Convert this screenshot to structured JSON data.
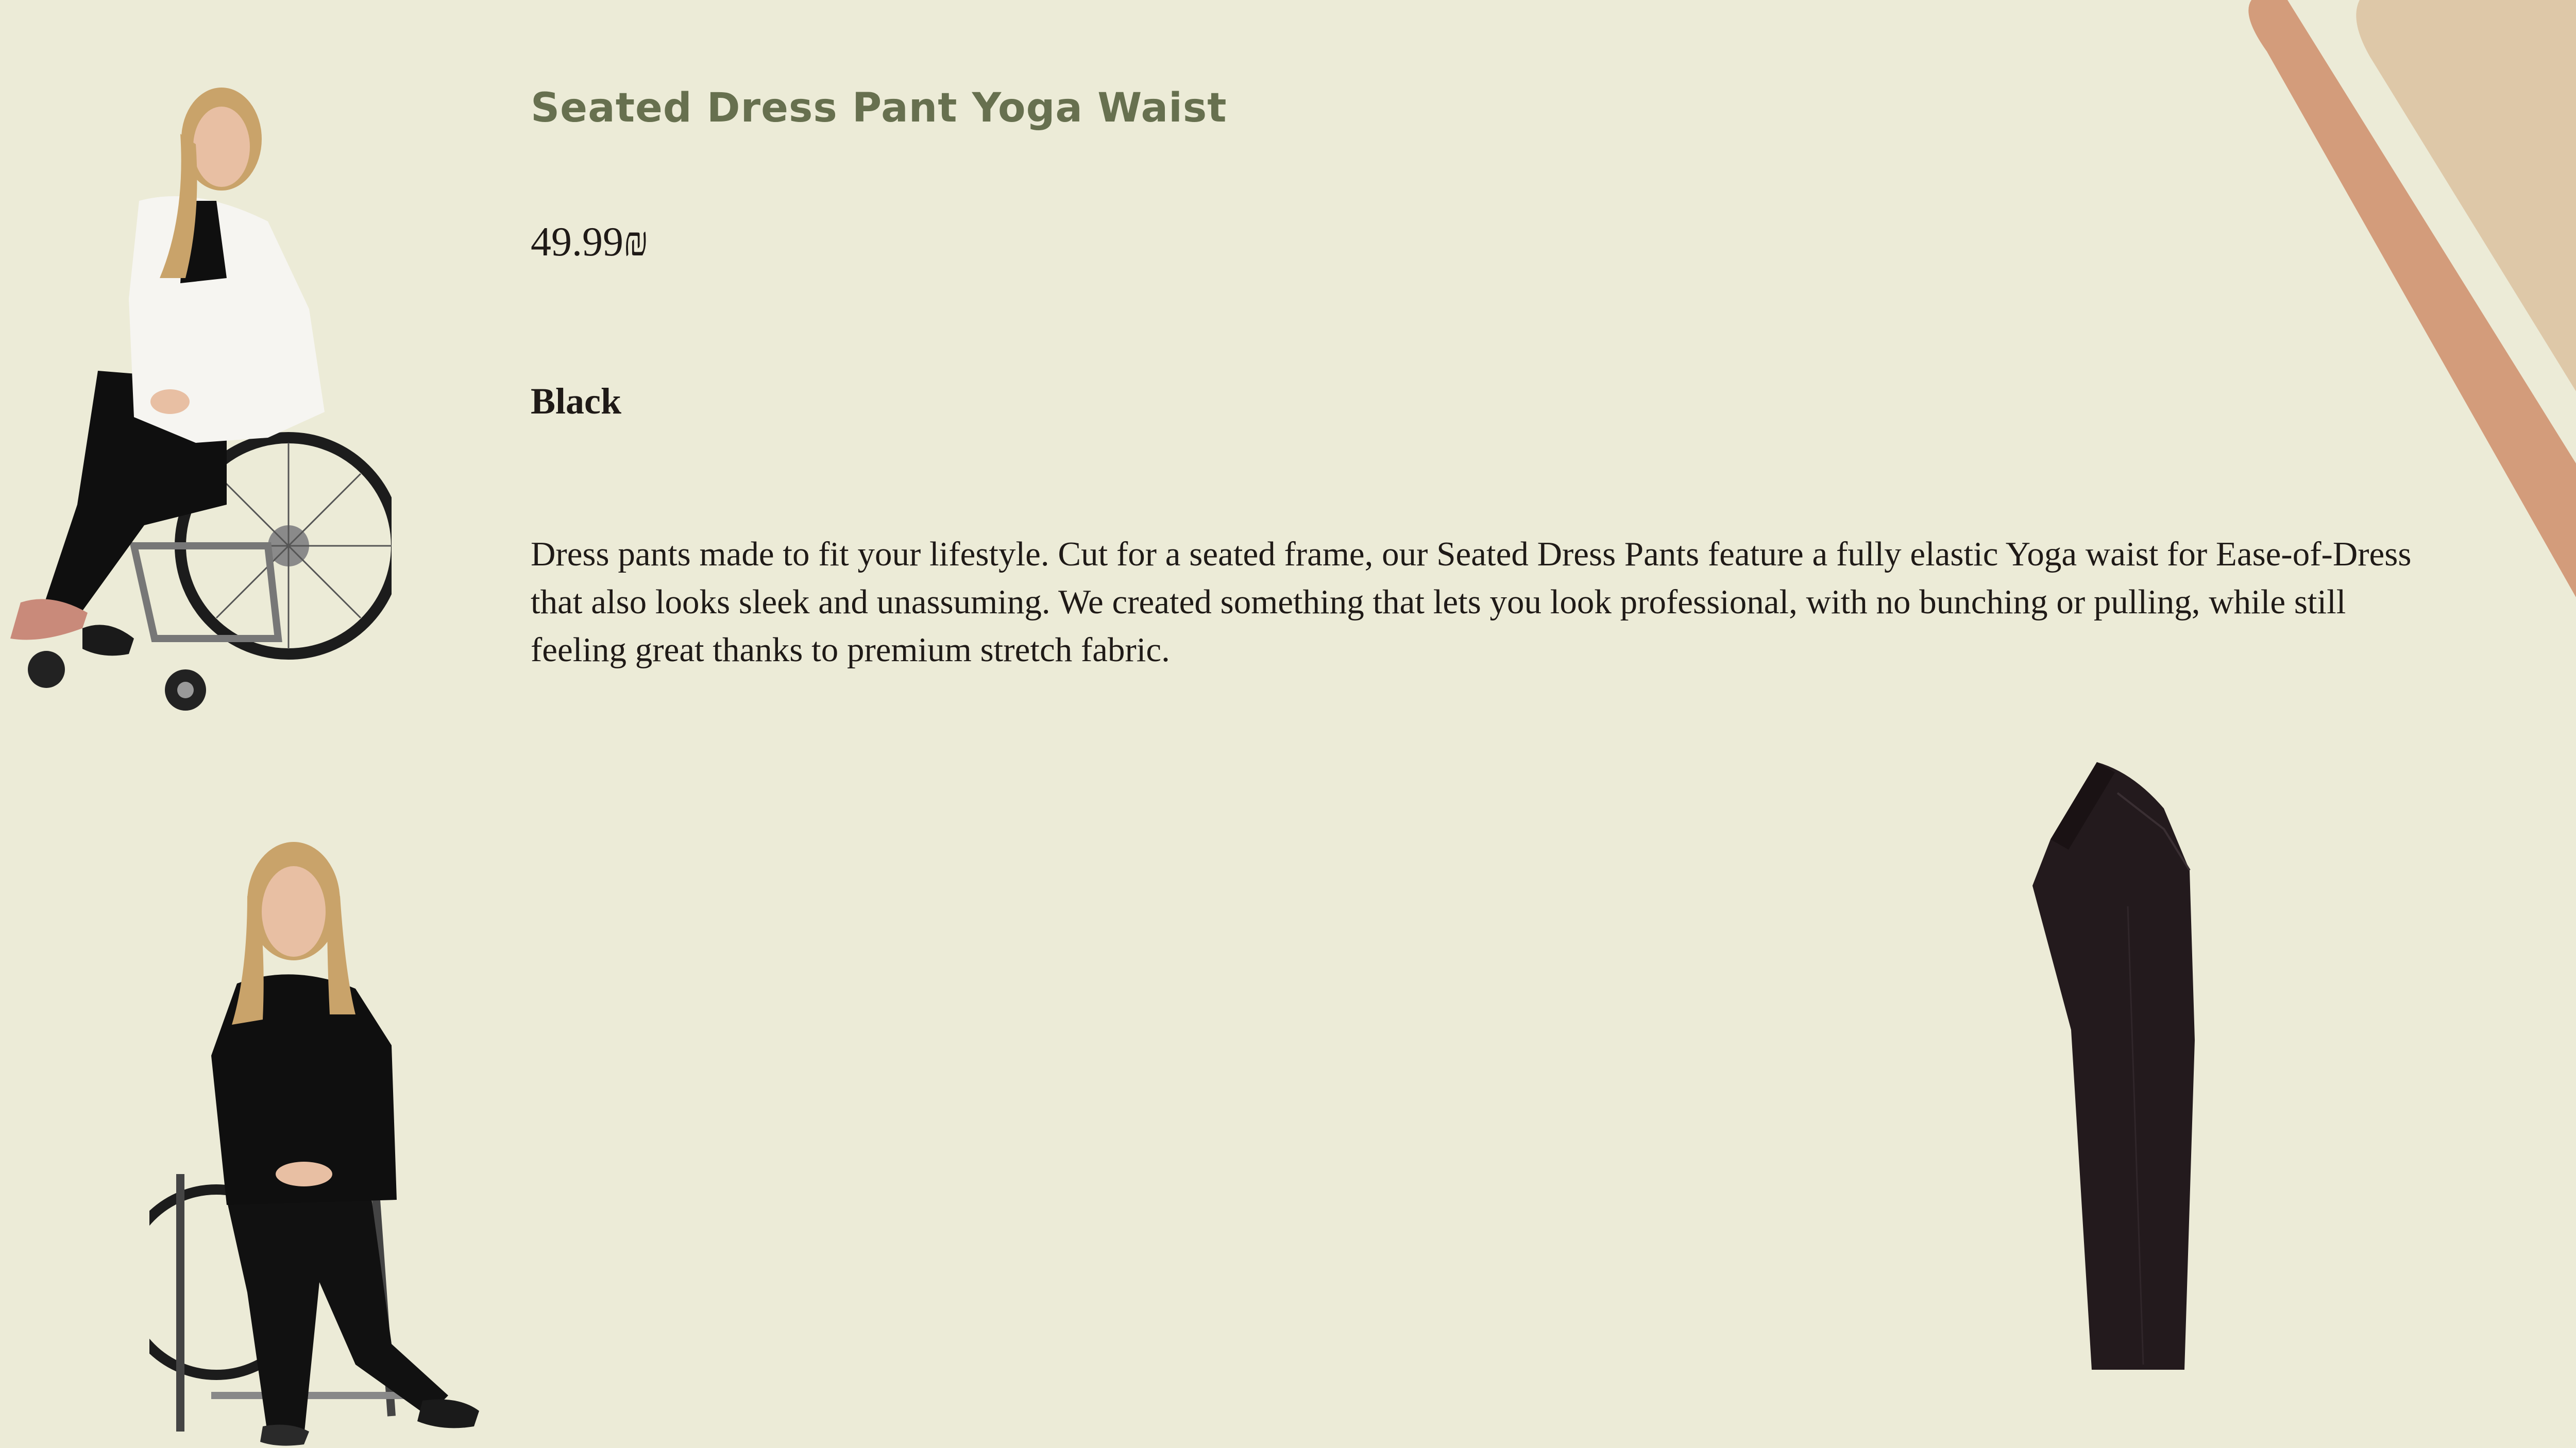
{
  "product": {
    "title": "Seated Dress Pant Yoga Waist",
    "price": "49.99₪",
    "color": "Black",
    "description": "Dress pants made to fit your lifestyle. Cut for a seated frame, our Seated Dress Pants feature a fully elastic Yoga waist for Ease-of-Dress that also looks sleek and unassuming. We created something that lets you look professional, with no bunching or pulling, while still feeling great thanks to premium stretch fabric."
  },
  "theme": {
    "background": "#ECEBD7",
    "title_color": "#67704F",
    "text_color": "#1F1A17",
    "accent_outer": "#D39C7B",
    "accent_inner": "#DEC8A8"
  },
  "images": {
    "model_top": "woman-in-wheelchair-white-wrap",
    "model_bottom": "woman-in-wheelchair-black-outfit",
    "product": "black-seated-dress-pant"
  }
}
